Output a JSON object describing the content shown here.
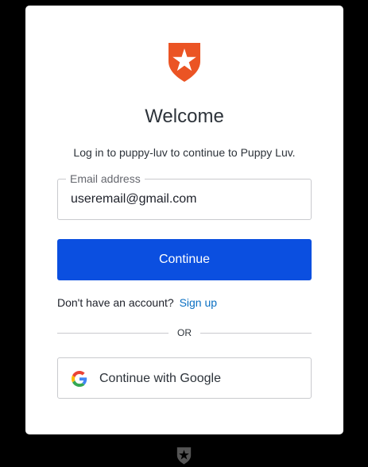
{
  "header": {
    "title": "Welcome",
    "subtitle": "Log in to puppy-luv to continue to Puppy Luv."
  },
  "form": {
    "email_label": "Email address",
    "email_value": "useremail@gmail.com",
    "continue_label": "Continue"
  },
  "signup": {
    "prompt": "Don't have an account?",
    "link_label": "Sign up"
  },
  "divider": {
    "label": "OR"
  },
  "social": {
    "google_label": "Continue with Google"
  },
  "icons": {
    "brand_logo": "auth0-shield-icon",
    "google": "google-icon",
    "footer_logo": "auth0-footer-icon"
  },
  "colors": {
    "brand": "#eb5424",
    "primary_button": "#0b4fe0",
    "link": "#0a6fc2",
    "text": "#2d333a"
  }
}
